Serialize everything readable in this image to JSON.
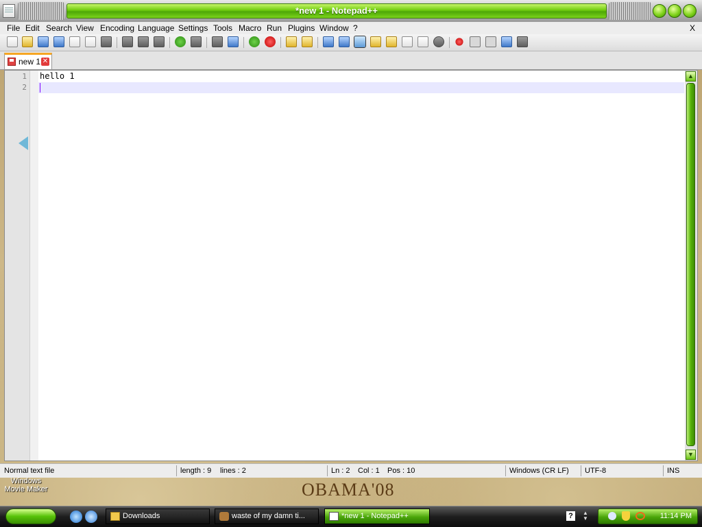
{
  "window": {
    "title": "*new 1 - Notepad++",
    "minimize_icon": "circle-button",
    "maximize_icon": "circle-button",
    "close_icon": "circle-button",
    "accent": "#6fcb0d"
  },
  "menu": {
    "items": [
      "File",
      "Edit",
      "Search",
      "View",
      "Encoding",
      "Language",
      "Settings",
      "Tools",
      "Macro",
      "Run",
      "Plugins",
      "Window",
      "?"
    ],
    "close": "X"
  },
  "tabs": [
    {
      "label": "new 1",
      "modified": true
    }
  ],
  "editor": {
    "lines": [
      {
        "number": "1",
        "text": "hello 1"
      },
      {
        "number": "2",
        "text": ""
      }
    ]
  },
  "status": {
    "file_type": "Normal text file",
    "length": "length : 9",
    "lines": "lines : 2",
    "ln": "Ln : 2",
    "col": "Col : 1",
    "pos": "Pos : 10",
    "eol": "Windows (CR LF)",
    "encoding": "UTF-8",
    "mode": "INS"
  },
  "desktop": {
    "shortcut_label": "Windows Movie Maker",
    "logo_text": "OBAMA'08"
  },
  "taskbar": {
    "buttons": [
      {
        "label": "Downloads",
        "active": false
      },
      {
        "label": "waste of my damn ti...",
        "active": false
      },
      {
        "label": "*new 1 - Notepad++",
        "active": true
      }
    ],
    "clock": "11:14 PM",
    "help_badge": "?"
  }
}
